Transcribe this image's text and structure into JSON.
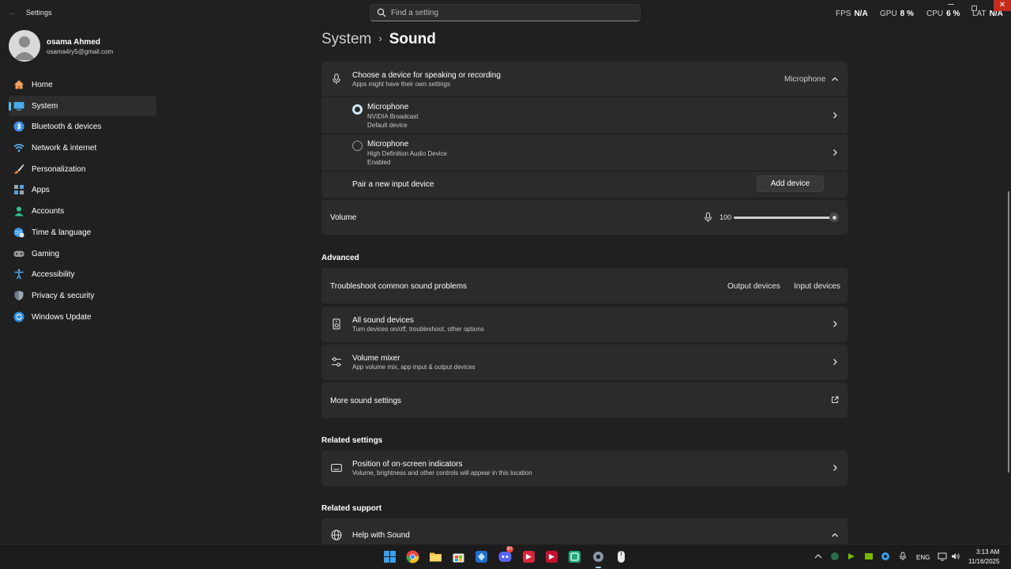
{
  "app": {
    "title": "Settings",
    "back_icon": "arrow-left-icon"
  },
  "search": {
    "placeholder": "Find a setting"
  },
  "overlay": {
    "fps_label": "FPS",
    "fps_value": "N/A",
    "gpu_label": "GPU",
    "gpu_value": "8 %",
    "cpu_label": "CPU",
    "cpu_value": "6 %",
    "lat_label": "LAT",
    "lat_value": "N/A"
  },
  "window": {
    "close_icon": "close-icon",
    "close_color": "#c42b1c"
  },
  "user": {
    "name": "osama Ahmed",
    "email": "osama4ry5@gmail.com"
  },
  "sidebar": {
    "accent": "#4cc2ff",
    "items": [
      {
        "label": "Home",
        "icon": "home-icon"
      },
      {
        "label": "System",
        "icon": "system-icon",
        "active": true
      },
      {
        "label": "Bluetooth & devices",
        "icon": "bluetooth-icon"
      },
      {
        "label": "Network & internet",
        "icon": "wifi-icon"
      },
      {
        "label": "Personalization",
        "icon": "brush-icon"
      },
      {
        "label": "Apps",
        "icon": "apps-icon"
      },
      {
        "label": "Accounts",
        "icon": "person-icon"
      },
      {
        "label": "Time & language",
        "icon": "globe-clock-icon"
      },
      {
        "label": "Gaming",
        "icon": "gamepad-icon"
      },
      {
        "label": "Accessibility",
        "icon": "accessibility-icon"
      },
      {
        "label": "Privacy & security",
        "icon": "shield-icon"
      },
      {
        "label": "Windows Update",
        "icon": "update-icon"
      }
    ]
  },
  "breadcrumb": {
    "parent": "System",
    "separator": "›",
    "current": "Sound"
  },
  "input": {
    "header_title": "Choose a device for speaking or recording",
    "header_subtitle": "Apps might have their own settings",
    "header_value": "Microphone",
    "devices": [
      {
        "name": "Microphone",
        "detail": "NVIDIA Broadcast",
        "status": "Default device",
        "selected": true
      },
      {
        "name": "Microphone",
        "detail": "High Definition Audio Device",
        "status": "Enabled",
        "selected": false
      }
    ],
    "pair_label": "Pair a new input device",
    "add_button": "Add device"
  },
  "volume": {
    "label": "Volume",
    "value": "100",
    "level": 1.0
  },
  "advanced": {
    "title": "Advanced",
    "troubleshoot_label": "Troubleshoot common sound problems",
    "output_link": "Output devices",
    "input_link": "Input devices",
    "all_devices_title": "All sound devices",
    "all_devices_subtitle": "Turn devices on/off, troubleshoot, other options",
    "mixer_title": "Volume mixer",
    "mixer_subtitle": "App volume mix, app input & output devices",
    "more_label": "More sound settings"
  },
  "related_settings": {
    "title": "Related settings",
    "osd_title": "Position of on-screen indicators",
    "osd_subtitle": "Volume, brightness and other controls will appear in this location"
  },
  "related_support": {
    "title": "Related support",
    "help_title": "Help with Sound"
  },
  "taskbar": {
    "apps": [
      "windows-start-icon",
      "chrome-icon",
      "file-explorer-icon",
      "store-icon",
      "app-icon",
      "discord-icon",
      "app-red-icon",
      "app-red-icon",
      "app-green-icon",
      "settings-gear-icon",
      "mouse-icon"
    ],
    "discord_badge": "9+",
    "language": "ENG",
    "time": "3:13 AM",
    "date": "11/16/2025"
  }
}
